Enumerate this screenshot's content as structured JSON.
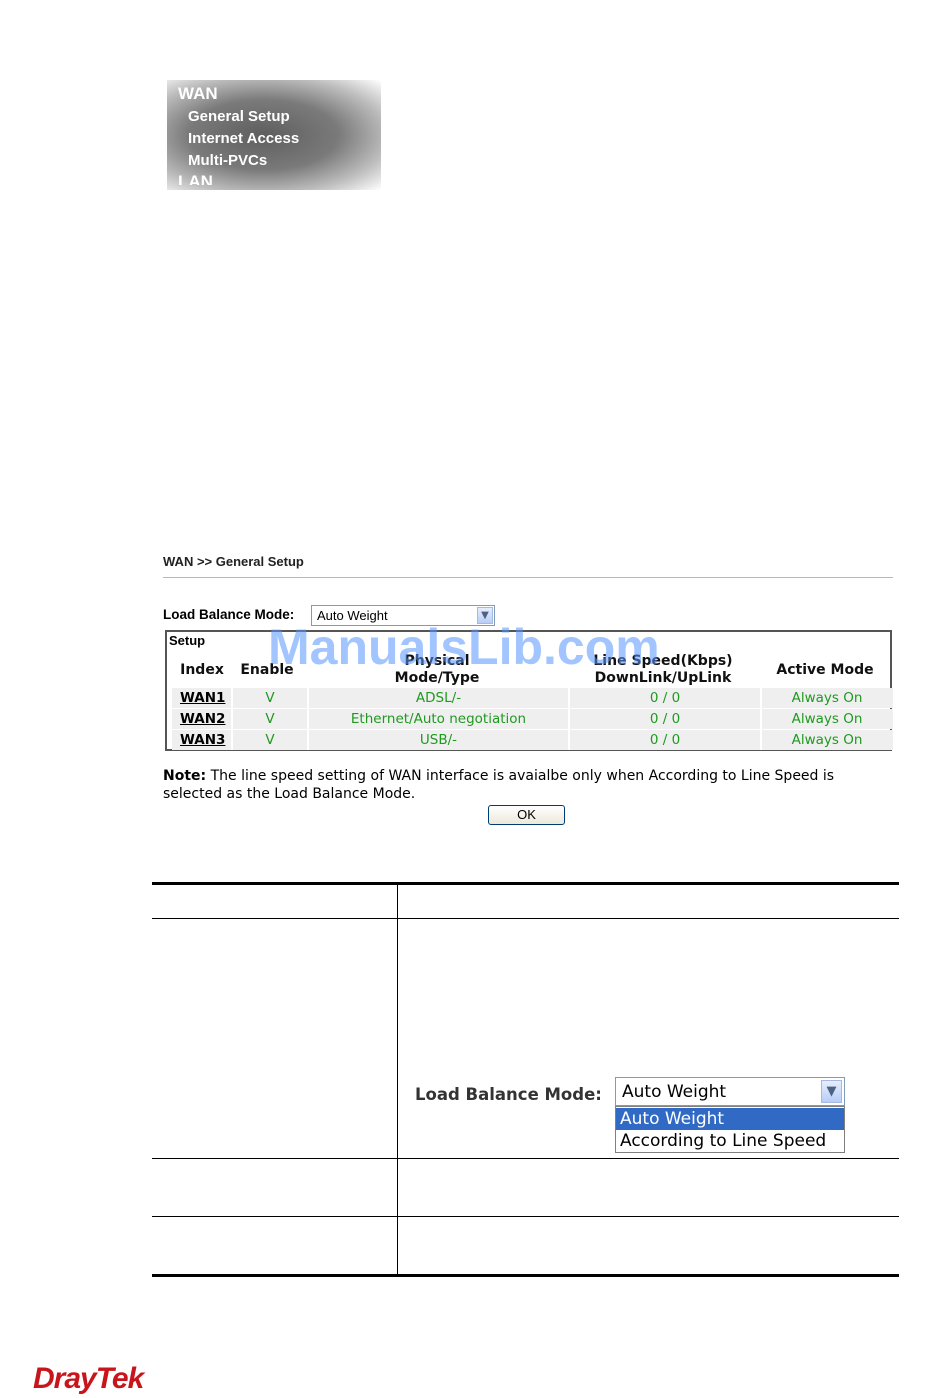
{
  "menu": {
    "title": "WAN",
    "items": [
      "General Setup",
      "Internet Access",
      "Multi-PVCs"
    ],
    "cut_item": "LAN"
  },
  "breadcrumb": "WAN >> General Setup",
  "load_balance": {
    "label": "Load Balance Mode:",
    "value": "Auto Weight"
  },
  "setup": {
    "title": "Setup",
    "headers": {
      "index": "Index",
      "enable": "Enable",
      "physical_1": "Physical",
      "physical_2": "Mode/Type",
      "speed_1": "Line Speed(Kbps)",
      "speed_2": "DownLink/UpLink",
      "active": "Active Mode"
    },
    "rows": [
      {
        "index": "WAN1",
        "enable": "V",
        "mode": "ADSL/-",
        "speed": "0 / 0",
        "active": "Always On"
      },
      {
        "index": "WAN2",
        "enable": "V",
        "mode": "Ethernet/Auto negotiation",
        "speed": "0 / 0",
        "active": "Always On"
      },
      {
        "index": "WAN3",
        "enable": "V",
        "mode": "USB/-",
        "speed": "0 / 0",
        "active": "Always On"
      }
    ]
  },
  "watermark": "ManualsLib.com",
  "note": {
    "label": "Note:",
    "text": "The line speed setting of WAN interface is avaialbe only when According to Line Speed is selected as the Load Balance Mode."
  },
  "ok_label": "OK",
  "dropdown": {
    "label": "Load Balance Mode:",
    "value": "Auto Weight",
    "options": [
      "Auto Weight",
      "According to Line Speed"
    ]
  },
  "logo": {
    "part1": "Dray",
    "part2": "Tek"
  }
}
